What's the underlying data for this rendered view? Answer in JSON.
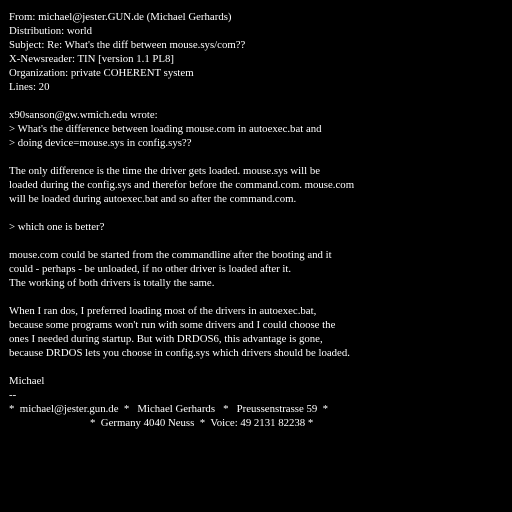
{
  "colors": {
    "background": "#000000",
    "text": "#ffffff"
  },
  "header": {
    "from": "From: michael@jester.GUN.de (Michael Gerhards)",
    "distribution": "Distribution: world",
    "subject": "Subject: Re: What's the diff between mouse.sys/com??",
    "newsreader": "X-Newsreader: TIN [version 1.1 PL8]",
    "organization": "Organization: private COHERENT system",
    "lines": "Lines: 20"
  },
  "quote": {
    "attribution": "x90sanson@gw.wmich.edu wrote:",
    "lines": [
      "> What's the difference between loading mouse.com in autoexec.bat and",
      "> doing device=mouse.sys in config.sys??"
    ]
  },
  "para1": [
    "The only difference is the time the driver gets loaded. mouse.sys will be",
    "loaded during the config.sys and therefor before the command.com. mouse.com",
    "will be loaded during autoexec.bat and so after the command.com."
  ],
  "quote2": "> which one is better?",
  "para2": [
    "mouse.com could be started from the commandline after the booting and it",
    "could - perhaps - be unloaded, if no other driver is loaded after it.",
    "The working of both drivers is totally the same."
  ],
  "para3": [
    "When I ran dos, I preferred loading most of the drivers in autoexec.bat,",
    "because some programs won't run with some drivers and I could choose the",
    "ones I needed during startup. But with DRDOS6, this advantage is gone,",
    "because DRDOS lets you choose in config.sys which drivers should be loaded."
  ],
  "signature": {
    "name": "Michael",
    "separator": "--",
    "line1": "*  michael@jester.gun.de  *   Michael Gerhards   *   Preussenstrasse 59  *",
    "line2": "                              *  Germany 4040 Neuss  *  Voice: 49 2131 82238 *"
  }
}
